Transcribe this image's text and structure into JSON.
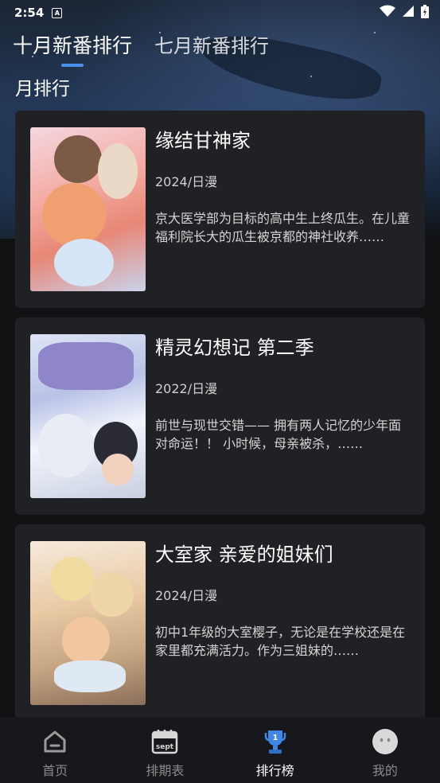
{
  "status_bar": {
    "time": "2:54",
    "notification_letter": "A"
  },
  "tabs": [
    {
      "label": "十月新番排行",
      "active": true
    },
    {
      "label": "七月新番排行",
      "active": false
    }
  ],
  "section_title": "月排行",
  "cards": [
    {
      "title": "缘结甘神家",
      "meta": "2024/日漫",
      "description": "京大医学部为目标的高中生上终瓜生。在儿童福利院长大的瓜生被京都的神社收养……"
    },
    {
      "title": "精灵幻想记 第二季",
      "meta": "2022/日漫",
      "description": "前世与现世交错—— 拥有两人记忆的少年面对命运！！ 小时候，母亲被杀，……"
    },
    {
      "title": "大室家 亲爱的姐妹们",
      "meta": "2024/日漫",
      "description": "初中1年级的大室樱子，无论是在学校还是在家里都充满活力。作为三姐妹的……"
    }
  ],
  "bottom_nav": [
    {
      "label": "首页",
      "icon": "home-icon",
      "active": false
    },
    {
      "label": "排期表",
      "icon": "calendar-icon",
      "icon_text": "sept",
      "active": false
    },
    {
      "label": "排行榜",
      "icon": "trophy-icon",
      "icon_text": "1",
      "active": true
    },
    {
      "label": "我的",
      "icon": "profile-icon",
      "active": false
    }
  ],
  "colors": {
    "accent": "#4c8fe8",
    "card_bg": "#202124",
    "nav_bg": "#17181b"
  }
}
